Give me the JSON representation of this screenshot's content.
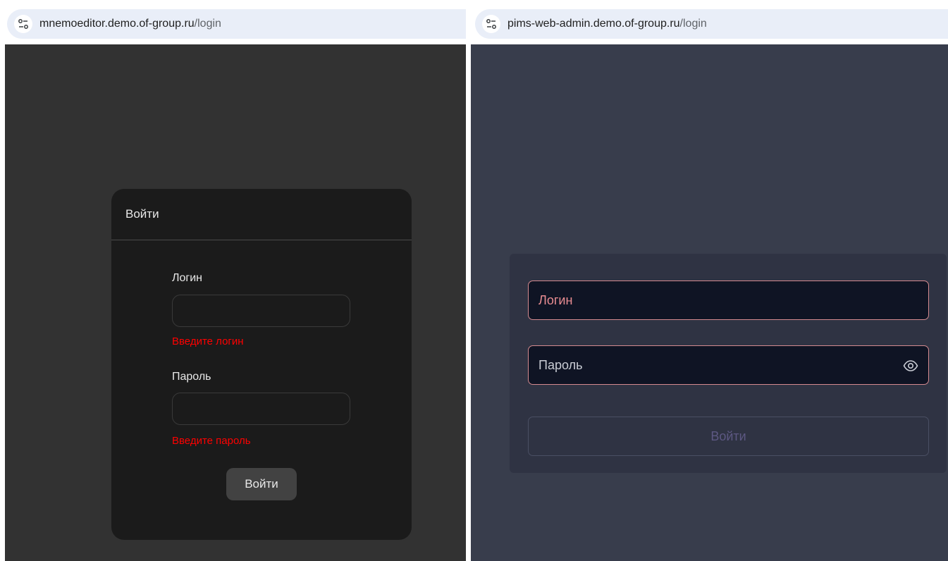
{
  "left": {
    "url": {
      "host": "mnemoeditor.demo.of-group.ru",
      "path": "/login"
    },
    "card_title": "Войти",
    "login_label": "Логин",
    "login_value": "",
    "login_error": "Введите логин",
    "password_label": "Пароль",
    "password_value": "",
    "password_error": "Введите пароль",
    "submit_label": "Войти"
  },
  "right": {
    "url": {
      "host": "pims-web-admin.demo.of-group.ru",
      "path": "/login"
    },
    "login_placeholder": "Логин",
    "password_placeholder": "Пароль",
    "submit_label": "Войти"
  },
  "colors": {
    "left_background": "#323232",
    "left_card": "#1b1b1b",
    "error_text": "#ff0000",
    "right_background": "#383d4c",
    "right_card": "#2f3343",
    "right_input_border": "#d48a8f",
    "right_button_text": "#5d5883"
  },
  "icons": {
    "site_info": "tune-icon",
    "password_toggle": "eye-icon"
  }
}
